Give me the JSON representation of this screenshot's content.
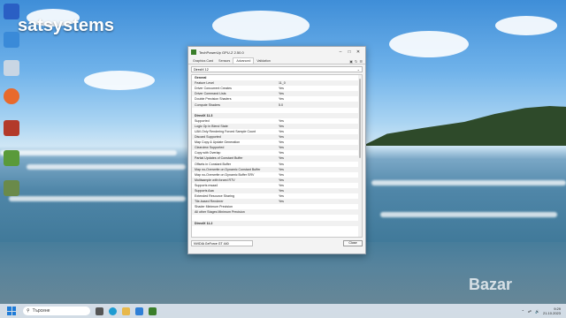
{
  "watermark": {
    "brand": "satsystems",
    "bazar": "Bazar"
  },
  "window": {
    "title": "TechPowerUp GPU-Z 2.50.0",
    "tabs": [
      "Graphics Card",
      "Sensors",
      "Advanced",
      "Validation"
    ],
    "active_tab": "Advanced",
    "selector": "DirectX 12",
    "footer_gpu": "NVIDIA GeForce GT 440",
    "close_label": "Close"
  },
  "table": [
    {
      "k": "General",
      "v": "",
      "head": true
    },
    {
      "k": "Feature Level",
      "v": "11_0"
    },
    {
      "k": "Driver Concurrent Creates",
      "v": "Yes"
    },
    {
      "k": "Driver Command Lists",
      "v": "Yes"
    },
    {
      "k": "Double Precision Shaders",
      "v": "Yes"
    },
    {
      "k": "Compute Shaders",
      "v": "5.0"
    },
    {
      "k": "",
      "v": ""
    },
    {
      "k": "DirectX 11.3",
      "v": "",
      "head": true
    },
    {
      "k": "Supported",
      "v": "Yes"
    },
    {
      "k": "Logic Op in Blend State",
      "v": "Yes"
    },
    {
      "k": "UAV-Only Rendering Forced Sample Count",
      "v": "Yes"
    },
    {
      "k": "Discard Supported",
      "v": "Yes"
    },
    {
      "k": "Map Copy & Update Generation",
      "v": "Yes"
    },
    {
      "k": "Clearview Supported",
      "v": "Yes"
    },
    {
      "k": "Copy with Overlap",
      "v": "Yes"
    },
    {
      "k": "Partial Updates of Constant Buffer",
      "v": "Yes"
    },
    {
      "k": "Offsets in Constant Buffer",
      "v": "Yes"
    },
    {
      "k": "Map no-Overwrite on Dynamic Constant Buffer",
      "v": "Yes"
    },
    {
      "k": "Map no-Overwrite on Dynamic Buffer SRV",
      "v": "Yes"
    },
    {
      "k": "Multisample with forced RTV",
      "v": "Yes"
    },
    {
      "k": "Supports msaa4",
      "v": "Yes"
    },
    {
      "k": "Supports Aaa",
      "v": "Yes"
    },
    {
      "k": "Extended Resource Sharing",
      "v": "Yes"
    },
    {
      "k": "Tile-based Renderer",
      "v": "Yes"
    },
    {
      "k": "Shader Minimum Precision",
      "v": ""
    },
    {
      "k": "All other Stages Minimum Precision",
      "v": ""
    },
    {
      "k": "",
      "v": ""
    },
    {
      "k": "DirectX 11.2",
      "v": "",
      "head": true
    }
  ],
  "taskbar": {
    "search_placeholder": "Търсене",
    "time": "9:29",
    "date": "21.10.2023"
  }
}
